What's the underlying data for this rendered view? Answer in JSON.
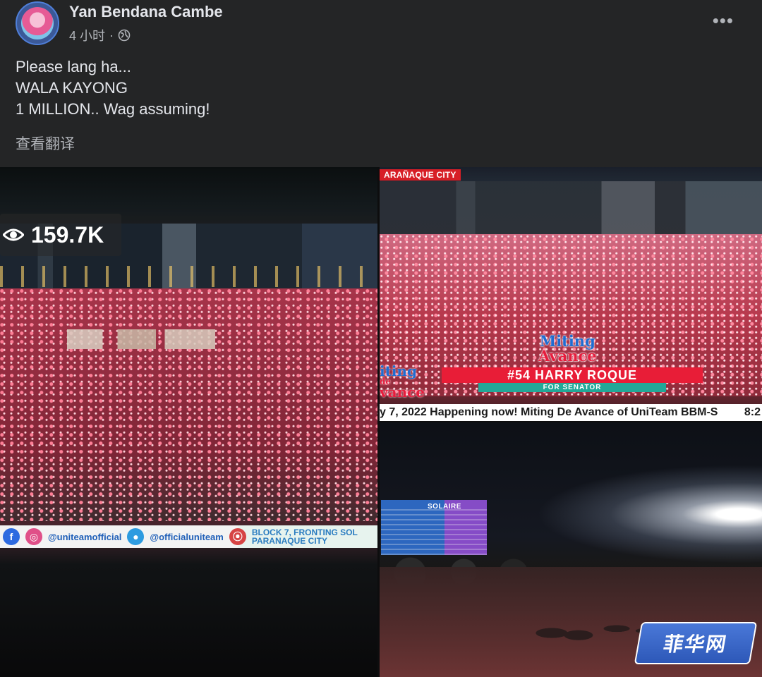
{
  "post": {
    "author": "Yan Bendana Cambe",
    "time": "4 小时",
    "separator": "·",
    "privacy_icon": "globe-icon",
    "more_icon": "more-horizontal-icon",
    "more_label": "•••",
    "text_lines": [
      "Please lang ha...",
      "WALA KAYONG",
      "1 MILLION.. Wag assuming!"
    ],
    "translate_label": "查看翻译"
  },
  "photos": {
    "photo1": {
      "views": "159.7K",
      "banner": {
        "handle1": "@uniteamofficial",
        "handle2": "@officialuniteam",
        "location_line1": "BLOCK 7, FRONTING SOL",
        "location_line2": "PARANAQUE CITY"
      }
    },
    "photo2": {
      "city_tag": "ARAÑAQUE CITY",
      "logo_line1": "Miting",
      "logo_line2": "Avance",
      "left_logo_line1": "iting",
      "left_logo_line2": "de",
      "left_logo_line3": "vance",
      "candidate": "#54 HARRY ROQUE",
      "for": "FOR SENATOR",
      "ticker": "y 7, 2022 Happening now! Miting De Avance of UniTeam BBM-S",
      "ticker_time": "8:2"
    },
    "photo3": {
      "hotel_sign": "SOLAIRE"
    }
  },
  "watermark": {
    "text": "菲华网"
  },
  "colors": {
    "background": "#242526",
    "primary_text": "#e4e6eb",
    "secondary_text": "#b0b3b8",
    "accent_red": "#e81d37",
    "accent_teal": "#22a898"
  }
}
